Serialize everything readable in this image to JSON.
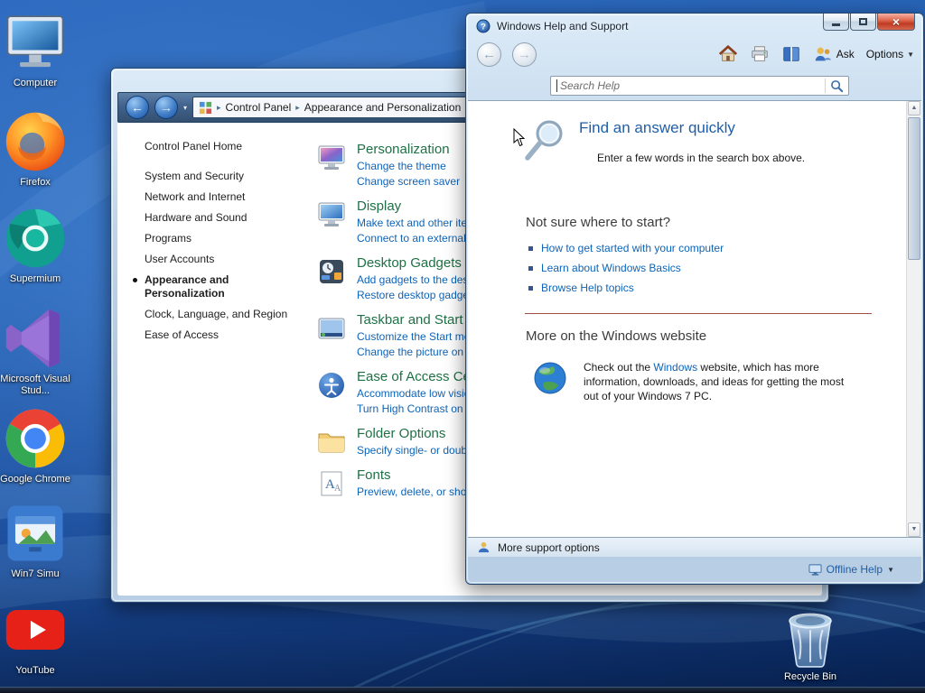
{
  "colors": {
    "link_blue": "#0d64b8",
    "category_green": "#1e7145",
    "heading_blue": "#1f5fa8",
    "divider_red": "#9c4f42",
    "close_button_red": "#c03a22"
  },
  "desktop": {
    "icons": [
      {
        "label": "Computer"
      },
      {
        "label": "Firefox"
      },
      {
        "label": "Supermium"
      },
      {
        "label": "Microsoft Visual Stud..."
      },
      {
        "label": "Google Chrome"
      },
      {
        "label": "Win7 Simu"
      },
      {
        "label": "YouTube"
      }
    ],
    "recycle_bin": {
      "label": "Recycle Bin"
    }
  },
  "control_panel": {
    "breadcrumb": {
      "root": "Control Panel",
      "current": "Appearance and Personalization"
    },
    "sidebar": {
      "items": [
        {
          "label": "Control Panel Home"
        },
        {
          "label": "System and Security"
        },
        {
          "label": "Network and Internet"
        },
        {
          "label": "Hardware and Sound"
        },
        {
          "label": "Programs"
        },
        {
          "label": "User Accounts"
        },
        {
          "label": "Appearance and Personalization"
        },
        {
          "label": "Clock, Language, and Region"
        },
        {
          "label": "Ease of Access"
        }
      ]
    },
    "categories": [
      {
        "title": "Personalization",
        "tasks": [
          "Change the theme",
          "Change screen saver"
        ]
      },
      {
        "title": "Display",
        "tasks": [
          "Make text and other items larger or smaller",
          "Connect to an external display"
        ]
      },
      {
        "title": "Desktop Gadgets",
        "tasks": [
          "Add gadgets to the desktop",
          "Restore desktop gadgets installed with Windows"
        ]
      },
      {
        "title": "Taskbar and Start Menu",
        "tasks": [
          "Customize the Start menu",
          "Change the picture on the Start menu"
        ]
      },
      {
        "title": "Ease of Access Center",
        "tasks": [
          "Accommodate low vision",
          "Turn High Contrast on or off"
        ]
      },
      {
        "title": "Folder Options",
        "tasks": [
          "Specify single- or double-click to open"
        ]
      },
      {
        "title": "Fonts",
        "tasks": [
          "Preview, delete, or show and hide fonts"
        ]
      }
    ]
  },
  "help": {
    "title": "Windows Help and Support",
    "toolbar": {
      "ask": "Ask",
      "options": "Options"
    },
    "search": {
      "placeholder": "Search Help",
      "value": ""
    },
    "content": {
      "quick_title": "Find an answer quickly",
      "quick_sub": "Enter a few words in the search box above.",
      "start_title": "Not sure where to start?",
      "links": [
        {
          "label": "How to get started with your computer"
        },
        {
          "label": "Learn about Windows Basics"
        },
        {
          "label": "Browse Help topics"
        }
      ],
      "website_title": "More on the Windows website",
      "website_pre": "Check out the ",
      "website_link": "Windows",
      "website_post": " website, which has more information, downloads, and ideas for getting the most out of your Windows 7 PC."
    },
    "footer": {
      "more_support": "More support options",
      "offline_help": "Offline Help"
    }
  }
}
